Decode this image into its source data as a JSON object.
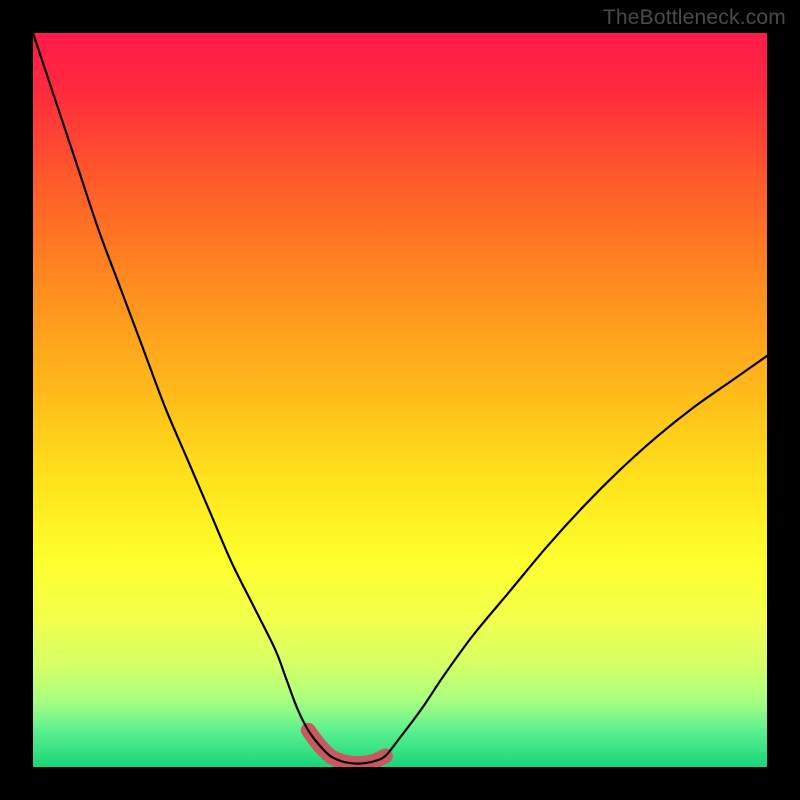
{
  "watermark": "TheBottleneck.com",
  "colors": {
    "frame": "#000000",
    "gradient_stops": [
      {
        "offset": 0.0,
        "color": "#ff1a49"
      },
      {
        "offset": 0.08,
        "color": "#ff2b3e"
      },
      {
        "offset": 0.2,
        "color": "#ff5a2a"
      },
      {
        "offset": 0.35,
        "color": "#ff8e1f"
      },
      {
        "offset": 0.5,
        "color": "#ffbe1a"
      },
      {
        "offset": 0.62,
        "color": "#ffe61c"
      },
      {
        "offset": 0.72,
        "color": "#ffff2e"
      },
      {
        "offset": 0.8,
        "color": "#f2ff4d"
      },
      {
        "offset": 0.86,
        "color": "#d6ff66"
      },
      {
        "offset": 0.91,
        "color": "#a8ff80"
      },
      {
        "offset": 0.95,
        "color": "#5cf08f"
      },
      {
        "offset": 1.0,
        "color": "#17d679"
      }
    ],
    "curve": "#000000",
    "highlight": "#c9595f"
  },
  "chart_data": {
    "type": "line",
    "title": "",
    "xlabel": "",
    "ylabel": "",
    "xlim": [
      0,
      100
    ],
    "ylim": [
      0,
      100
    ],
    "x": [
      0,
      3,
      6,
      9,
      12,
      15,
      18,
      21,
      24,
      27,
      30,
      33,
      34.5,
      36,
      37.5,
      39,
      40.5,
      42,
      43.5,
      45,
      46.5,
      48,
      50,
      53,
      56,
      60,
      65,
      70,
      75,
      80,
      85,
      90,
      95,
      100
    ],
    "values": [
      100,
      91,
      82,
      73,
      65,
      57,
      49,
      42,
      35,
      28,
      22,
      16,
      12,
      8,
      5,
      3,
      1.5,
      0.8,
      0.5,
      0.5,
      0.8,
      1.5,
      4,
      8,
      12.5,
      18,
      24,
      30,
      35.5,
      40.5,
      45,
      49,
      52.5,
      56
    ],
    "highlight_range": {
      "x_start": 33,
      "x_end": 48,
      "y_max": 5
    },
    "annotations": []
  }
}
